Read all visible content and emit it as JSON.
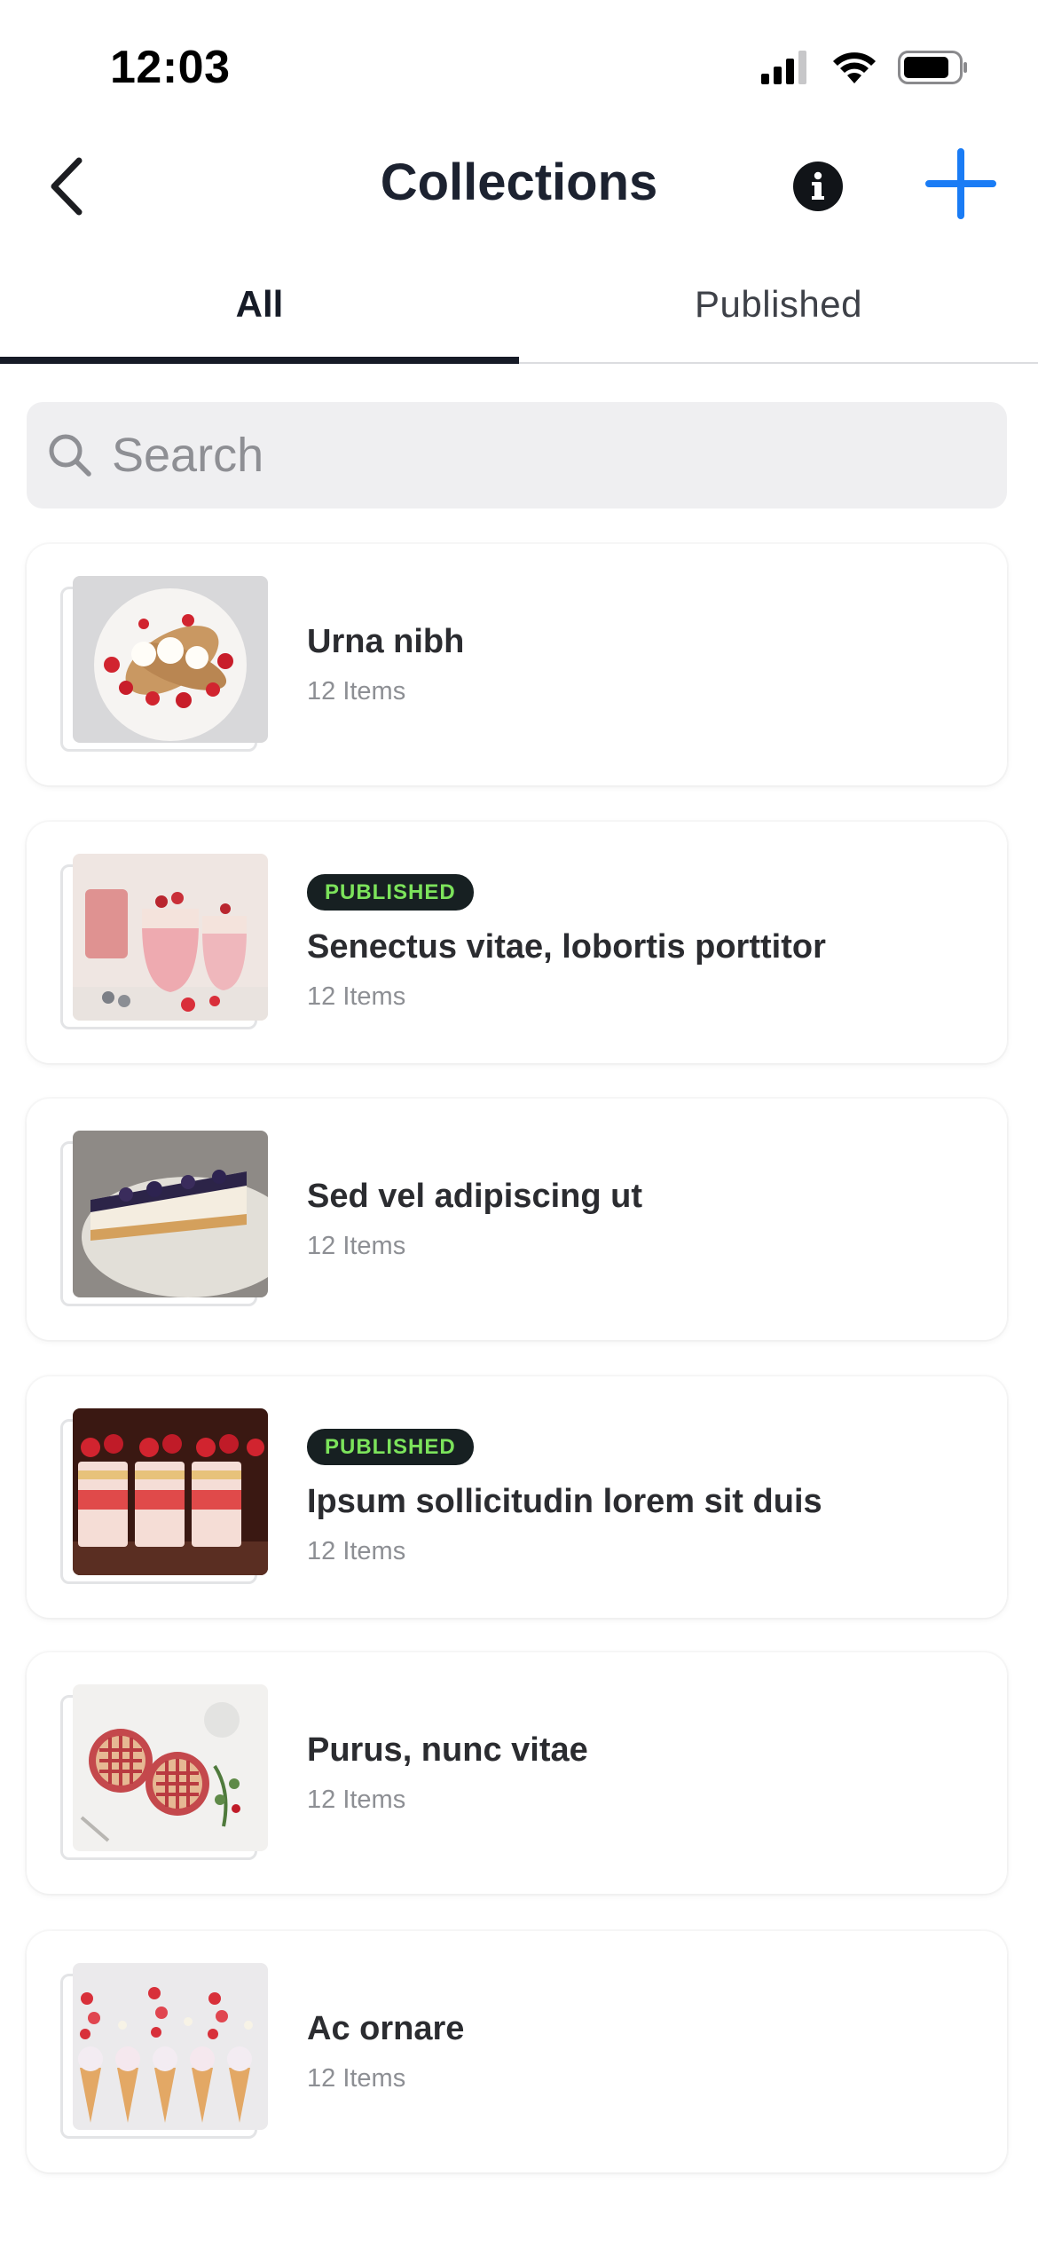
{
  "status_bar": {
    "time": "12:03"
  },
  "nav": {
    "title": "Collections",
    "back_icon": "chevron-left-icon",
    "info_icon": "info-icon",
    "add_icon": "plus-icon"
  },
  "tabs": [
    {
      "label": "All",
      "active": true
    },
    {
      "label": "Published",
      "active": false
    }
  ],
  "search": {
    "placeholder": "Search"
  },
  "collections": [
    {
      "title": "Urna nibh",
      "count": "12 Items",
      "badge": "",
      "thumbnail": "crepes-strawberries"
    },
    {
      "title": "Senectus vitae, lobortis porttitor",
      "count": "12 Items",
      "badge": "PUBLISHED",
      "thumbnail": "strawberry-desserts-jars"
    },
    {
      "title": "Sed vel adipiscing ut",
      "count": "12 Items",
      "badge": "",
      "thumbnail": "blueberry-cheesecake"
    },
    {
      "title": "Ipsum sollicitudin lorem sit duis",
      "count": "12 Items",
      "badge": "PUBLISHED",
      "thumbnail": "strawberry-cups"
    },
    {
      "title": "Purus, nunc vitae",
      "count": "12 Items",
      "badge": "",
      "thumbnail": "lattice-pies"
    },
    {
      "title": "Ac ornare",
      "count": "12 Items",
      "badge": "",
      "thumbnail": "ice-cream-cones"
    }
  ],
  "colors": {
    "accent": "#1a7cf5",
    "badge_bg": "#172022",
    "badge_text": "#7ce35b",
    "search_bg": "#efeff1"
  }
}
